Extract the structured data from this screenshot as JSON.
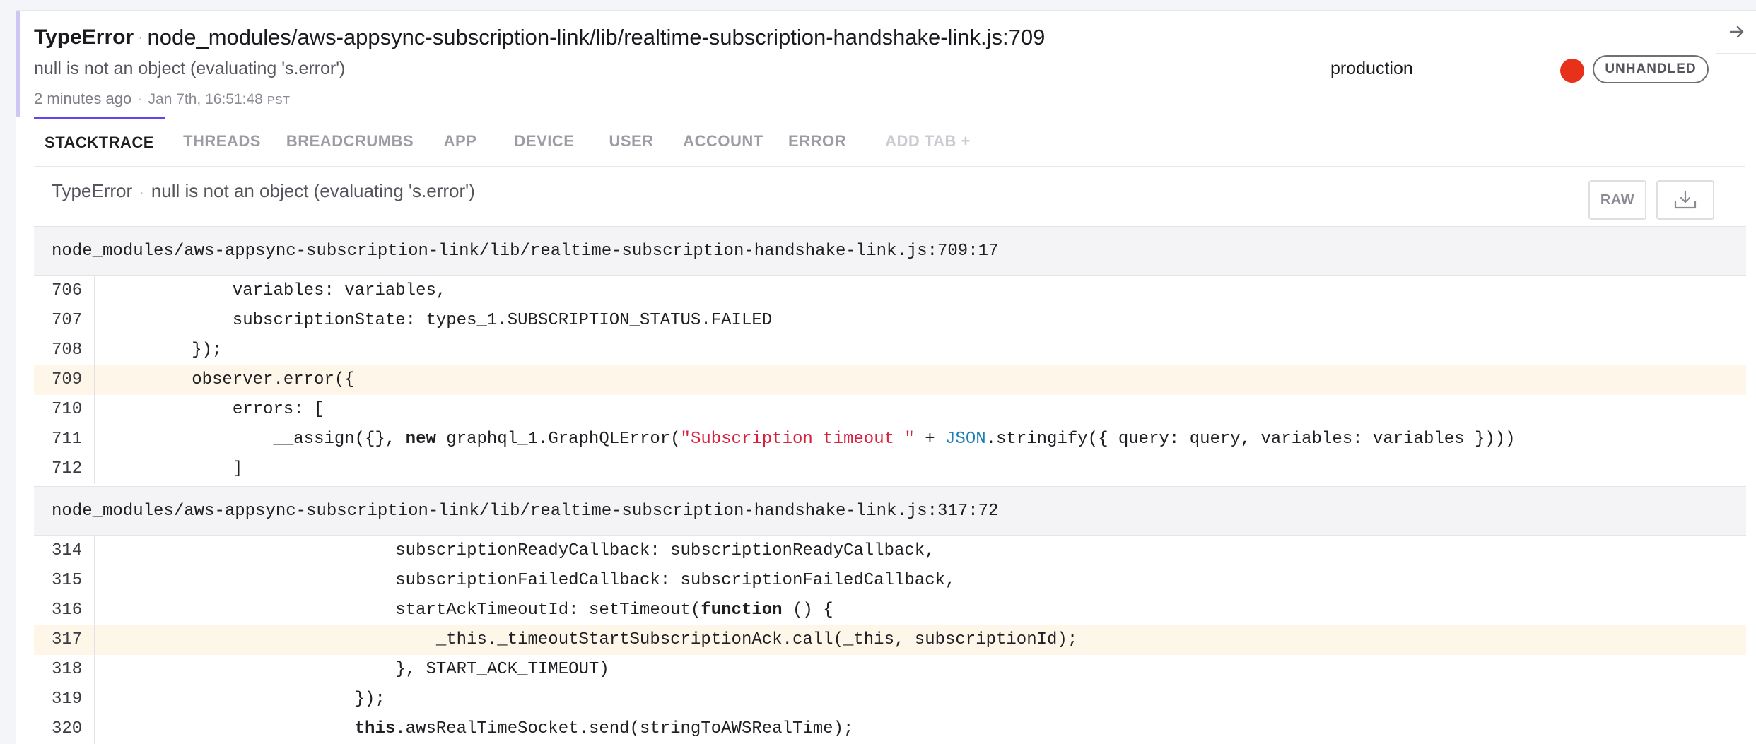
{
  "header": {
    "error_class": "TypeError",
    "title_separator": "·",
    "location": "node_modules/aws-appsync-subscription-link/lib/realtime-subscription-handshake-link.js:709",
    "message": "null is not an object (evaluating 's.error')",
    "relative_time": "2 minutes ago",
    "time_separator": "·",
    "absolute_time": "Jan 7th, 16:51:48",
    "timezone": "PST",
    "environment": "production",
    "severity_color": "#e8311a",
    "handled_state": "UNHANDLED",
    "close_icon": "arrow-right-icon"
  },
  "tabs": [
    {
      "label": "STACKTRACE",
      "active": true
    },
    {
      "label": "THREADS"
    },
    {
      "label": "BREADCRUMBS"
    },
    {
      "label": "APP"
    },
    {
      "label": "DEVICE"
    },
    {
      "label": "USER"
    },
    {
      "label": "ACCOUNT"
    },
    {
      "label": "ERROR"
    },
    {
      "label": "ADD TAB +"
    }
  ],
  "stacktrace": {
    "error_class": "TypeError",
    "separator": "·",
    "message": "null is not an object (evaluating 's.error')",
    "raw_label": "RAW",
    "download_icon": "download-icon",
    "frames": [
      {
        "file": "node_modules/aws-appsync-subscription-link/lib/realtime-subscription-handshake-link.js:709:17",
        "lines": [
          {
            "no": "706",
            "tokens": [
              {
                "t": "            variables: variables,"
              }
            ]
          },
          {
            "no": "707",
            "tokens": [
              {
                "t": "            subscriptionState: types_1.SUBSCRIPTION_STATUS.FAILED"
              }
            ]
          },
          {
            "no": "708",
            "tokens": [
              {
                "t": "        });"
              }
            ]
          },
          {
            "no": "709",
            "highlight": true,
            "tokens": [
              {
                "t": "        observer.error({"
              }
            ]
          },
          {
            "no": "710",
            "tokens": [
              {
                "t": "            errors: ["
              }
            ]
          },
          {
            "no": "711",
            "tokens": [
              {
                "t": "                __assign({}, "
              },
              {
                "t": "new",
                "c": "kw"
              },
              {
                "t": " graphql_1.GraphQLError("
              },
              {
                "t": "\"Subscription timeout \"",
                "c": "str"
              },
              {
                "t": " + "
              },
              {
                "t": "JSON",
                "c": "builtin"
              },
              {
                "t": ".stringify({ query: query, variables: variables })))"
              }
            ]
          },
          {
            "no": "712",
            "tokens": [
              {
                "t": "            ]"
              }
            ]
          }
        ]
      },
      {
        "file": "node_modules/aws-appsync-subscription-link/lib/realtime-subscription-handshake-link.js:317:72",
        "lines": [
          {
            "no": "314",
            "tokens": [
              {
                "t": "                            subscriptionReadyCallback: subscriptionReadyCallback,"
              }
            ]
          },
          {
            "no": "315",
            "tokens": [
              {
                "t": "                            subscriptionFailedCallback: subscriptionFailedCallback,"
              }
            ]
          },
          {
            "no": "316",
            "tokens": [
              {
                "t": "                            startAckTimeoutId: setTimeout("
              },
              {
                "t": "function",
                "c": "kw"
              },
              {
                "t": " () {"
              }
            ]
          },
          {
            "no": "317",
            "highlight": true,
            "tokens": [
              {
                "t": "                                _this._timeoutStartSubscriptionAck.call(_this, subscriptionId);"
              }
            ]
          },
          {
            "no": "318",
            "tokens": [
              {
                "t": "                            }, START_ACK_TIMEOUT)"
              }
            ]
          },
          {
            "no": "319",
            "tokens": [
              {
                "t": "                        });"
              }
            ]
          },
          {
            "no": "320",
            "tokens": [
              {
                "t": "                        "
              },
              {
                "t": "this",
                "c": "kw"
              },
              {
                "t": ".awsRealTimeSocket.send(stringToAWSRealTime);"
              }
            ]
          }
        ]
      }
    ]
  }
}
